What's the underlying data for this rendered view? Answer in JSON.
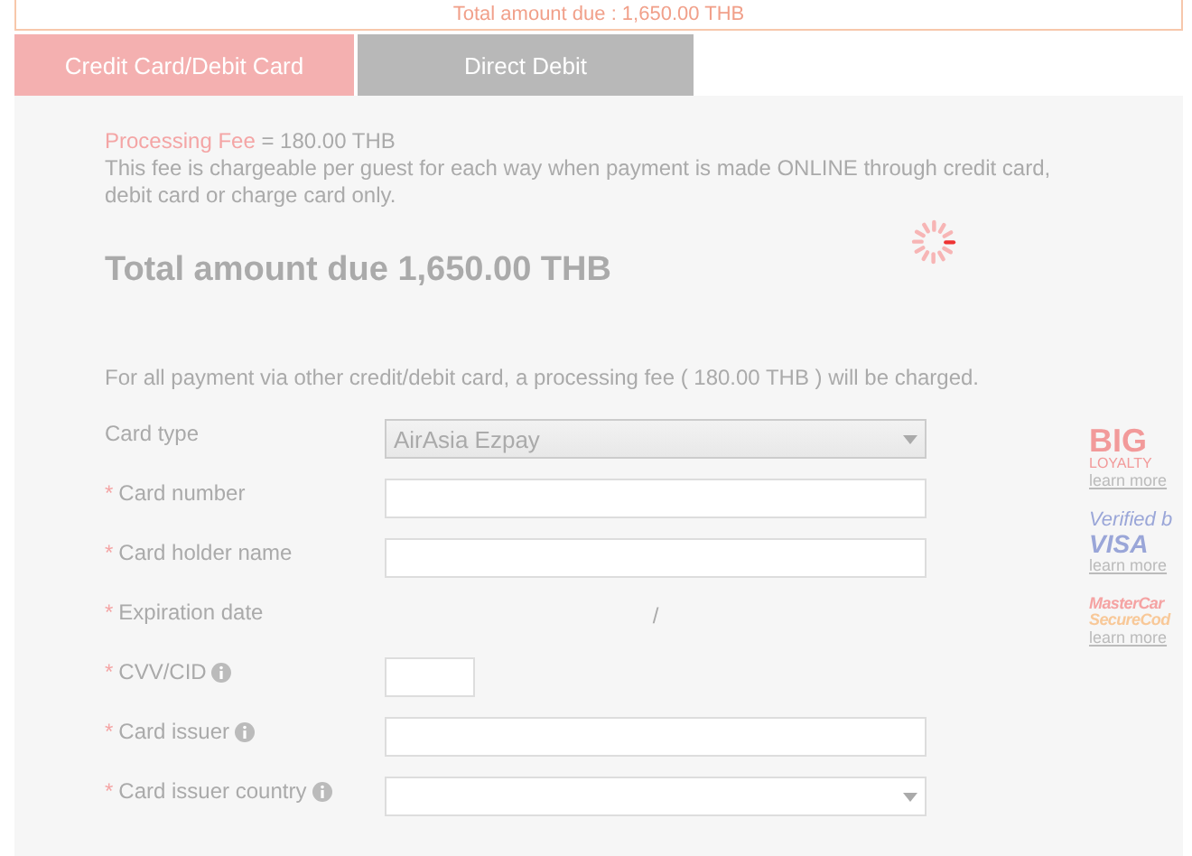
{
  "banner": {
    "text": "Total amount due : 1,650.00 THB"
  },
  "tabs": [
    {
      "label": "Credit Card/Debit Card",
      "selected": true
    },
    {
      "label": "Direct Debit",
      "selected": false
    }
  ],
  "fee": {
    "label": "Processing Fee",
    "value": "= 180.00 THB",
    "note": "This fee is chargeable per guest for each way when payment is made ONLINE through credit card, debit card or charge card only."
  },
  "total": "Total amount due 1,650.00 THB",
  "other_fee_note": "For all payment via other credit/debit card, a processing fee ( 180.00 THB ) will be charged.",
  "fields": [
    {
      "kind": "select",
      "label": "Card type",
      "value": "AirAsia Ezpay",
      "disabled": true,
      "info": false
    },
    {
      "kind": "text",
      "marker": "*",
      "label": "Card number",
      "info": false
    },
    {
      "kind": "text",
      "marker": "*",
      "label": "Card holder name",
      "info": false
    },
    {
      "kind": "expiry",
      "marker": "*",
      "label": "Expiration date",
      "separator": "/",
      "info": false
    },
    {
      "kind": "short",
      "marker": "*",
      "label": "CVV/CID",
      "info": true
    },
    {
      "kind": "text",
      "marker": "*",
      "label": "Card issuer",
      "info": true
    },
    {
      "kind": "select",
      "marker": "*",
      "label": "Card issuer country",
      "disabled": false,
      "info": true
    }
  ],
  "badges": [
    {
      "kind": "big",
      "line1": "BIG",
      "line2": "LOYALTY",
      "link": "learn more"
    },
    {
      "kind": "visa",
      "line1": "Verified b",
      "line2": "VISA",
      "link": "learn more"
    },
    {
      "kind": "mastercard",
      "line1": "MasterCar",
      "line2": "SecureCod",
      "link": "learn more"
    }
  ]
}
